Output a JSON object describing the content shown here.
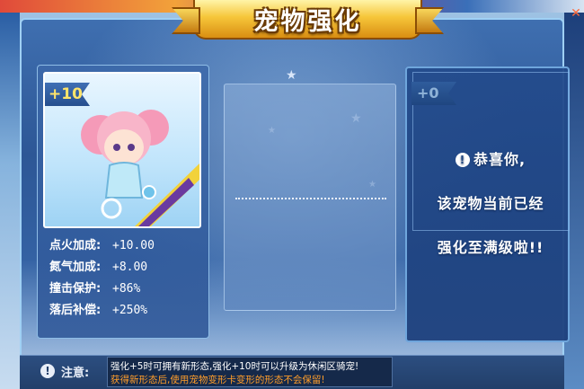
{
  "window": {
    "title": "宠物强化",
    "close_glyph": "✕"
  },
  "pet_card": {
    "level": "+10",
    "pet_icon": "pink-twin-tail-girl-pet"
  },
  "stats": [
    {
      "label": "点火加成:",
      "value": "+10.00"
    },
    {
      "label": "氮气加成:",
      "value": "+8.00"
    },
    {
      "label": "撞击保护:",
      "value": "+86%"
    },
    {
      "label": "落后补偿:",
      "value": "+250%"
    }
  ],
  "result_panel": {
    "level": "+0",
    "line1": "恭喜你,",
    "line2": "该宠物当前已经",
    "line3": "强化至满级啦!!",
    "alert_icon": "exclamation-circle-icon"
  },
  "notice": {
    "label": "注意:",
    "line1": "强化+5时可拥有新形态,强化+10时可以升级为休闲区骑宠!",
    "line2": "获得新形态后,使用宠物变形卡变形的形态不会保留!",
    "icon": "exclamation-circle-icon"
  },
  "colors": {
    "accent": "#f6c63a",
    "panel": "#2d5796",
    "level_text": "#ffe46a",
    "warning": "#ff9d2a"
  }
}
